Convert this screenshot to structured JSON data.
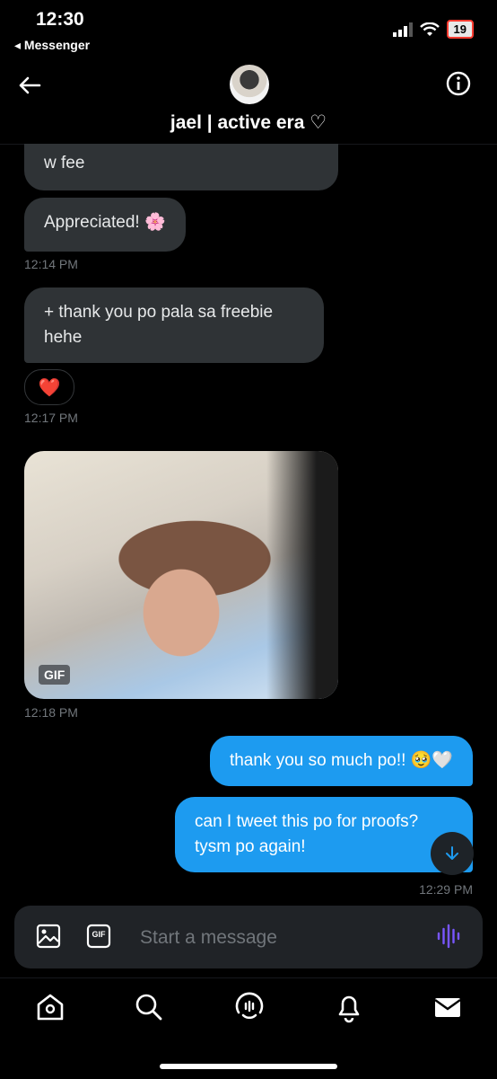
{
  "status": {
    "time": "12:30",
    "back_app": "◂ Messenger",
    "battery": "19"
  },
  "header": {
    "contact_name": "jael | active era ♡"
  },
  "messages": {
    "m1": {
      "text": "w fee"
    },
    "m2": {
      "text": "Appreciated! 🌸"
    },
    "t1": "12:14 PM",
    "m3": {
      "line1": "+ thank you po pala sa freebie",
      "line2": "hehe"
    },
    "reaction": "❤️",
    "t2": "12:17 PM",
    "gif_badge": "GIF",
    "t3": "12:18 PM",
    "m4": {
      "text": "thank you so much po!! 🥹🤍"
    },
    "m5": {
      "line1": "can I tweet this po for proofs?",
      "line2": "tysm po again!"
    },
    "t4": "12:29 PM"
  },
  "composer": {
    "placeholder": "Start a message",
    "gif_label": "GIF"
  },
  "colors": {
    "accent": "#1d9bf0",
    "incoming_bubble": "#2f3336",
    "voice": "#7856ff"
  },
  "icons": [
    "back-arrow-icon",
    "info-icon",
    "image-icon",
    "gif-icon",
    "voice-icon",
    "home-icon",
    "search-icon",
    "spaces-icon",
    "bell-icon",
    "mail-icon",
    "arrow-down-icon"
  ]
}
